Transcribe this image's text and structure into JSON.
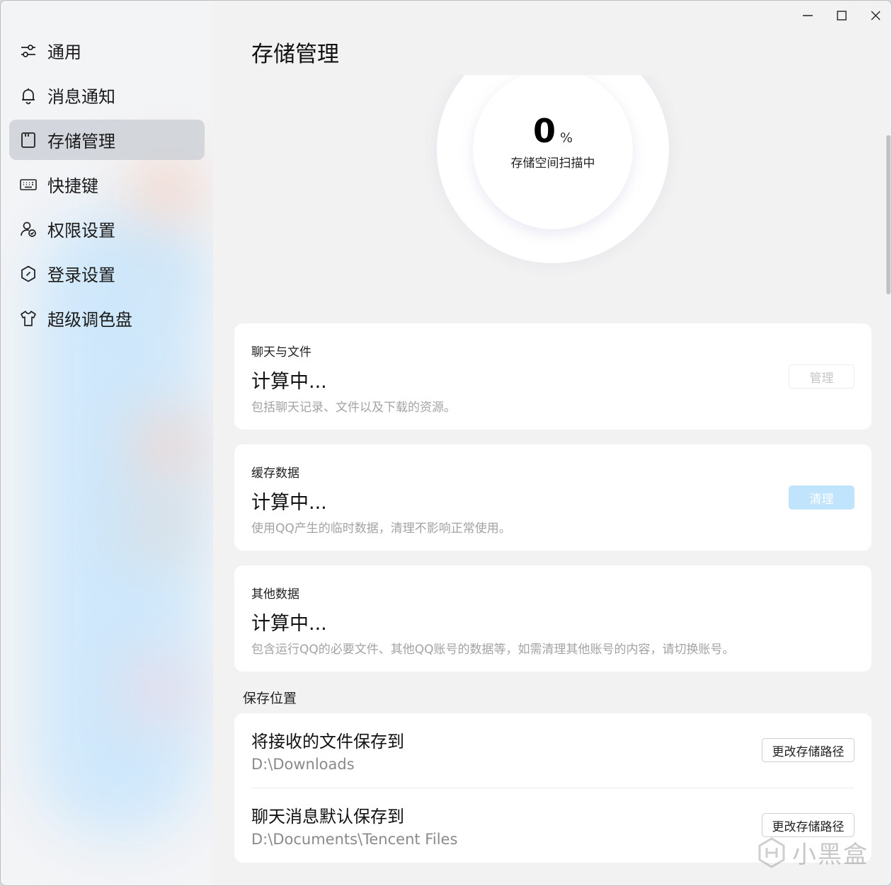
{
  "window": {
    "controls": [
      {
        "name": "minimize-button",
        "icon": "minimize-icon"
      },
      {
        "name": "maximize-button",
        "icon": "maximize-icon"
      },
      {
        "name": "close-button",
        "icon": "close-icon"
      }
    ]
  },
  "sidebar": {
    "items": [
      {
        "label": "通用",
        "icon": "sliders-icon",
        "active": false
      },
      {
        "label": "消息通知",
        "icon": "bell-icon",
        "active": false
      },
      {
        "label": "存储管理",
        "icon": "storage-icon",
        "active": true
      },
      {
        "label": "快捷键",
        "icon": "keyboard-icon",
        "active": false
      },
      {
        "label": "权限设置",
        "icon": "user-lock-icon",
        "active": false
      },
      {
        "label": "登录设置",
        "icon": "hexagon-icon",
        "active": false
      },
      {
        "label": "超级调色盘",
        "icon": "tshirt-icon",
        "active": false
      }
    ]
  },
  "page": {
    "title": "存储管理"
  },
  "usage": {
    "percent": "0",
    "unit": "%",
    "status": "存储空间扫描中"
  },
  "cards": [
    {
      "label": "聊天与文件",
      "value": "计算中...",
      "desc": "包括聊天记录、文件以及下载的资源。",
      "button": "管理"
    },
    {
      "label": "缓存数据",
      "value": "计算中...",
      "desc": "使用QQ产生的临时数据，清理不影响正常使用。",
      "button": "清理"
    },
    {
      "label": "其他数据",
      "value": "计算中...",
      "desc": "包含运行QQ的必要文件、其他QQ账号的数据等，如需清理其他账号的内容，请切换账号。"
    }
  ],
  "save_location": {
    "heading": "保存位置",
    "rows": [
      {
        "title": "将接收的文件保存到",
        "path": "D:\\Downloads",
        "button": "更改存储路径"
      },
      {
        "title": "聊天消息默认保存到",
        "path": "D:\\Documents\\Tencent Files",
        "button": "更改存储路径"
      }
    ]
  },
  "watermark": {
    "text": "小黑盒",
    "icon": "heybox-logo-icon"
  },
  "colors": {
    "accent_light": "#bfe4fb",
    "sidebar_active": "#c8cdd4",
    "card_bg": "#ffffff",
    "page_bg": "#f2f2f2"
  }
}
